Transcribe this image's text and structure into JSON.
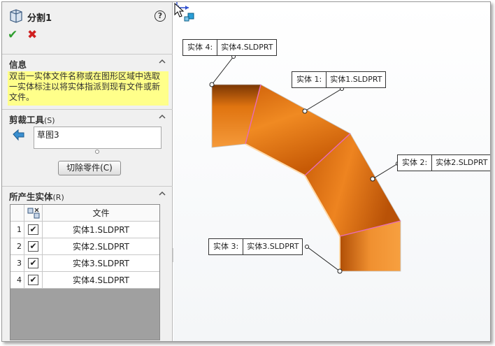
{
  "feature": {
    "title": "分割1"
  },
  "sections": {
    "info": {
      "label": "信息",
      "text": "双击一实体文件名称或在图形区域中选取一实体标注以将实体指派到现有文件或新文件。"
    },
    "trim": {
      "label": "剪裁工具",
      "shortcut": "(S)",
      "sketch": "草图3",
      "button": "切除零件(C)"
    },
    "bodies": {
      "label": "所产生实体",
      "shortcut": "(R)",
      "header_file": "文件",
      "rows": [
        {
          "num": "1",
          "checked": "✔",
          "file": "实体1.SLDPRT"
        },
        {
          "num": "2",
          "checked": "✔",
          "file": "实体2.SLDPRT"
        },
        {
          "num": "3",
          "checked": "✔",
          "file": "实体3.SLDPRT"
        },
        {
          "num": "4",
          "checked": "✔",
          "file": "实体4.SLDPRT"
        }
      ]
    }
  },
  "callouts": [
    {
      "key": "实体 4:",
      "value": "实体4.SLDPRT"
    },
    {
      "key": "实体 1:",
      "value": "实体1.SLDPRT"
    },
    {
      "key": "实体 2:",
      "value": "实体2.SLDPRT"
    },
    {
      "key": "实体 3:",
      "value": "实体3.SLDPRT"
    }
  ],
  "colors": {
    "part_orange": "#e8730e",
    "split_line": "#e86ab8",
    "accept": "#2f9e2f",
    "cancel": "#d02020",
    "info_bg": "#ffff8a"
  },
  "icons": [
    "split-feature-icon",
    "help-icon",
    "ok-check-icon",
    "cancel-x-icon",
    "sketch-arrow-icon",
    "collapse-caret-icon",
    "checkbox-icon",
    "cursor-icon",
    "axis-triad-icon"
  ]
}
